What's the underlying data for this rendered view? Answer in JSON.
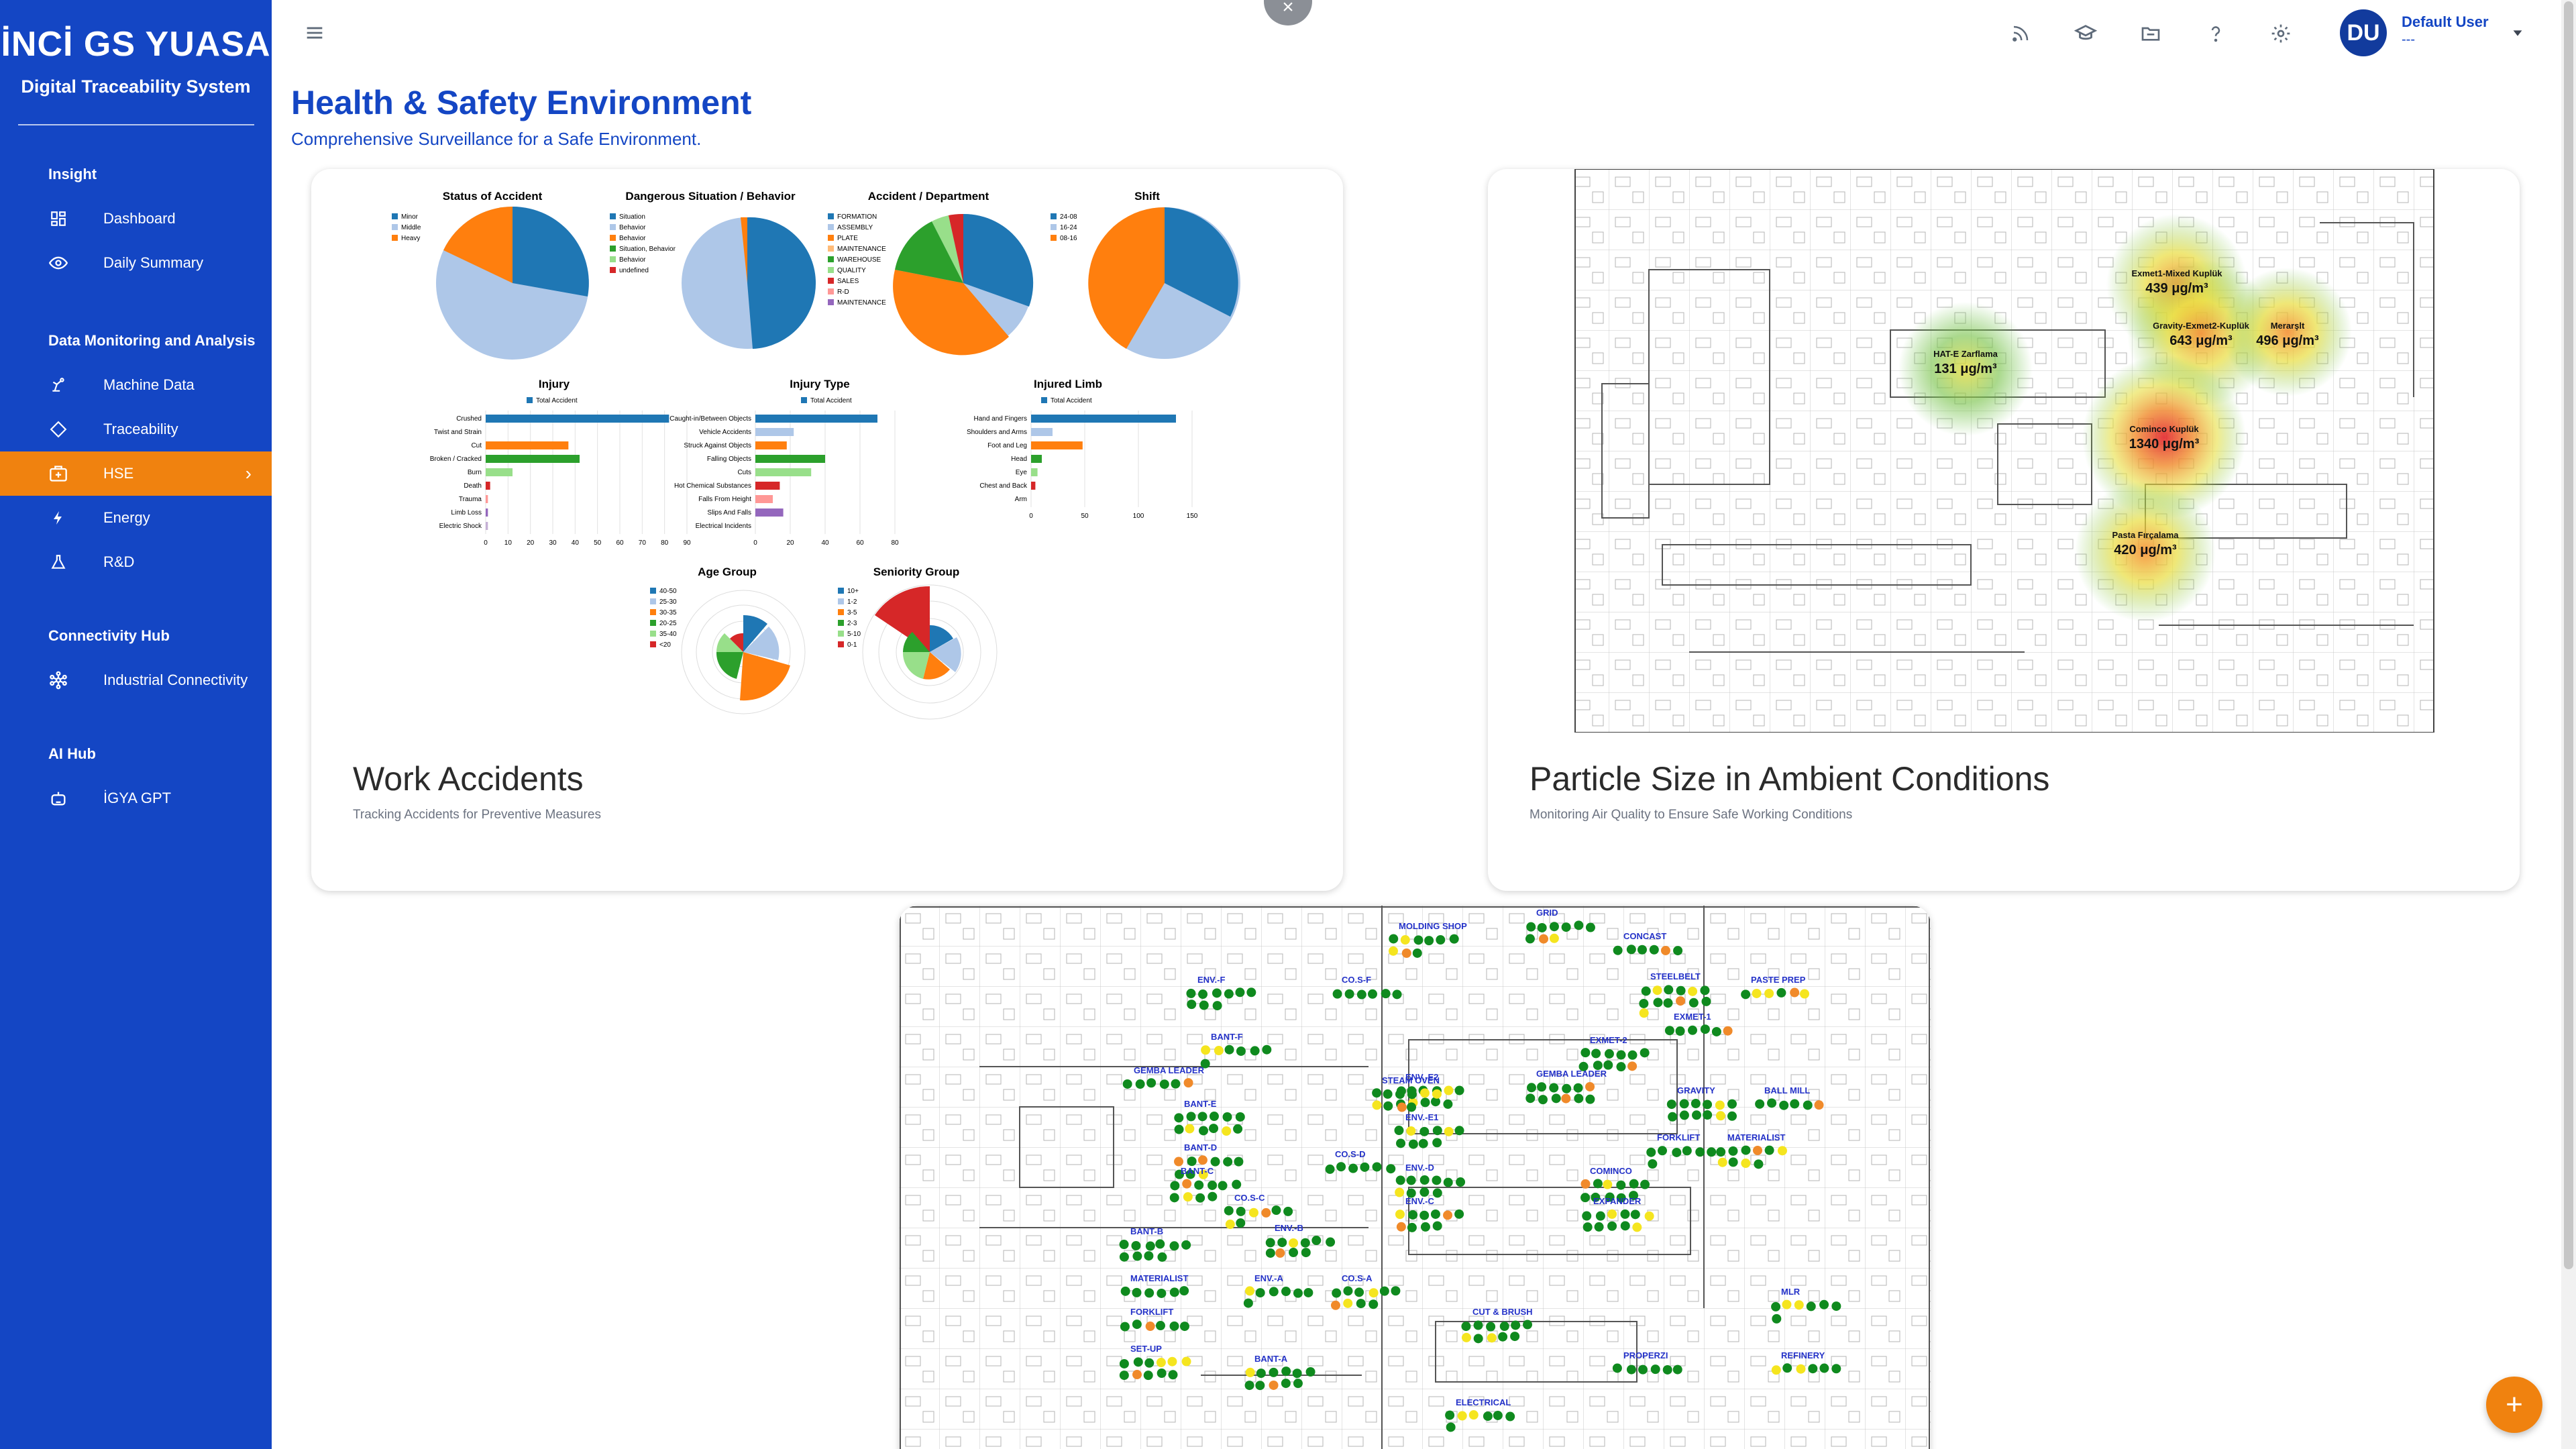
{
  "brand": {
    "logo": "İNCİ GS YUASA",
    "subtitle": "Digital Traceability System"
  },
  "sidebar": {
    "sections": [
      {
        "title": "Insight",
        "items": [
          {
            "label": "Dashboard",
            "icon": "dashboard-icon"
          },
          {
            "label": "Daily Summary",
            "icon": "eye-icon"
          }
        ]
      },
      {
        "title": "Data Monitoring and Analysis",
        "items": [
          {
            "label": "Machine Data",
            "icon": "machine-icon"
          },
          {
            "label": "Traceability",
            "icon": "diamond-icon"
          },
          {
            "label": "HSE",
            "icon": "first-aid-icon",
            "active": true
          },
          {
            "label": "Energy",
            "icon": "bolt-icon"
          },
          {
            "label": "R&D",
            "icon": "flask-icon"
          }
        ]
      },
      {
        "title": "Connectivity Hub",
        "items": [
          {
            "label": "Industrial Connectivity",
            "icon": "network-icon"
          }
        ]
      },
      {
        "title": "AI Hub",
        "items": [
          {
            "label": "İGYA GPT",
            "icon": "robot-icon"
          }
        ]
      }
    ]
  },
  "header": {
    "close_glyph": "×",
    "user_name": "Default User",
    "user_sub": "---",
    "avatar_initials": "DU"
  },
  "page": {
    "title": "Health & Safety Environment",
    "subtitle": "Comprehensive Surveillance for a Safe Environment."
  },
  "cards": [
    {
      "title": "Work Accidents",
      "subtitle": "Tracking Accidents for Preventive Measures"
    },
    {
      "title": "Particle Size in Ambient Conditions",
      "subtitle": "Monitoring Air Quality to Ensure Safe Working Conditions"
    }
  ],
  "accident_thumb": {
    "pies": [
      {
        "title": "Status of Accident",
        "legend": [
          "Minor",
          "Middle",
          "Heavy"
        ]
      },
      {
        "title": "Dangerous Situation / Behavior",
        "legend": [
          "Situation",
          "Behavior",
          "Behavior",
          "Situation, Behavior",
          "Behavior",
          "undefined"
        ]
      },
      {
        "title": "Accident / Department",
        "legend": [
          "FORMATION",
          "ASSEMBLY",
          "PLATE",
          "MAINTENANCE",
          "WAREHOUSE",
          "QUALITY",
          "SALES",
          "R-D",
          "MAINTENANCE"
        ]
      },
      {
        "title": "Shift",
        "legend": [
          "24-08",
          "16-24",
          "08-16"
        ]
      }
    ],
    "bars": [
      {
        "title": "Injury",
        "legend": "Total Accident",
        "labels": [
          "Crushed",
          "Twist and Strain",
          "Cut",
          "Broken / Cracked",
          "Burn",
          "Death",
          "Trauma",
          "Limb Loss",
          "Electric Shock"
        ],
        "values": [
          82,
          0,
          37,
          42,
          12,
          2,
          1,
          1,
          1
        ],
        "ticks": [
          "0",
          "10",
          "20",
          "30",
          "40",
          "50",
          "60",
          "70",
          "80",
          "90"
        ]
      },
      {
        "title": "Injury Type",
        "legend": "Total Accident",
        "labels": [
          "Caught-in/Between Objects",
          "Vehicle Accidents",
          "Struck Against Objects",
          "Falling Objects",
          "Cuts",
          "Hot Chemical Substances",
          "Falls From Height",
          "Slips And Falls",
          "Electrical Incidents"
        ],
        "values": [
          70,
          22,
          18,
          40,
          32,
          14,
          10,
          16,
          0
        ],
        "ticks": [
          "0",
          "20",
          "40",
          "60",
          "80"
        ]
      },
      {
        "title": "Injured Limb",
        "legend": "Total Accident",
        "labels": [
          "Hand and Fingers",
          "Shoulders and Arms",
          "Foot and Leg",
          "Head",
          "Eye",
          "Chest and Back",
          "Arm"
        ],
        "values": [
          135,
          20,
          48,
          10,
          6,
          4,
          0
        ],
        "ticks": [
          "0",
          "50",
          "100",
          "150"
        ]
      }
    ],
    "polars": [
      {
        "title": "Age Group",
        "legend": [
          "40-50",
          "25-30",
          "30-35",
          "20-25",
          "35-40",
          "<20"
        ]
      },
      {
        "title": "Seniority Group",
        "legend": [
          "10+",
          "1-2",
          "3-5",
          "2-3",
          "5-10",
          "0-1"
        ]
      }
    ]
  },
  "particle_map": {
    "readings": [
      {
        "name": "Exmet1-Mixed Kuplük",
        "value": "439 μg/m³"
      },
      {
        "name": "Gravity-Exmet2-Kuplük",
        "value": "643 μg/m³"
      },
      {
        "name": "Merarşlt",
        "value": "496 μg/m³"
      },
      {
        "name": "HAT-E Zarflama",
        "value": "131 μg/m³"
      },
      {
        "name": "Cominco Kuplük",
        "value": "1340 μg/m³"
      },
      {
        "name": "Pasta Fırçalama",
        "value": "420 μg/m³"
      }
    ]
  },
  "sensor_map": {
    "labels": [
      "MOLDING SHOP",
      "GRID",
      "CONCAST",
      "STEELBELT",
      "PASTE PREP",
      "ENV.-F",
      "CO.S-F",
      "EXMET-1",
      "BANT-F",
      "GEMBA LEADER",
      "EXMET-2",
      "ENV.-E2",
      "STEAM OVEN",
      "GEMBA LEADER",
      "GRAVITY",
      "BALL MILL",
      "BANT-E",
      "ENV.-E1",
      "FORKLIFT",
      "MATERIALIST",
      "BANT-D",
      "CO.S-D",
      "ENV.-D",
      "COMINCO",
      "BANT-C",
      "CO.S-C",
      "ENV.-C",
      "EXPANDER",
      "BANT-B",
      "ENV.-B",
      "MATERIALIST",
      "ENV.-A",
      "CO.S-A",
      "FORKLIFT",
      "CUT & BRUSH",
      "MLR",
      "SET-UP",
      "BANT-A",
      "PROPERZI",
      "REFINERY",
      "ELECTRICAL"
    ]
  }
}
